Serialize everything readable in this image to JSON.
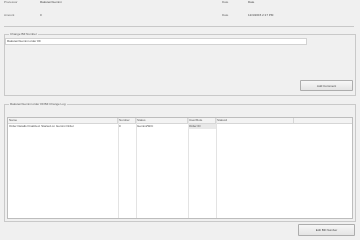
{
  "header": {
    "fields": [
      {
        "label": "Processor",
        "value": "Rakuten/Gemini"
      },
      {
        "label": "Amount",
        "value": "0"
      },
      {
        "label": "Date",
        "value": "Date"
      },
      {
        "label": "Date",
        "value": "12/4/2015 2:17 PM"
      }
    ]
  },
  "change_group": {
    "title": "Change Bill Number",
    "text": "Rakuten/Gemini order #9",
    "button_label": "Add Comment"
  },
  "grid_group": {
    "title": "Rakuten/Gemini order #9 Bill Change Log",
    "columns": [
      "Name",
      "Number",
      "Status",
      "User/Role",
      "Status2"
    ],
    "rows": [
      {
        "name": "Order Details Finalized. Started on Gemini Order",
        "number": "0",
        "status": "Gemini/SFC",
        "user": "Order ID"
      }
    ]
  },
  "footer": {
    "button_label": "Edit Bill Number"
  }
}
